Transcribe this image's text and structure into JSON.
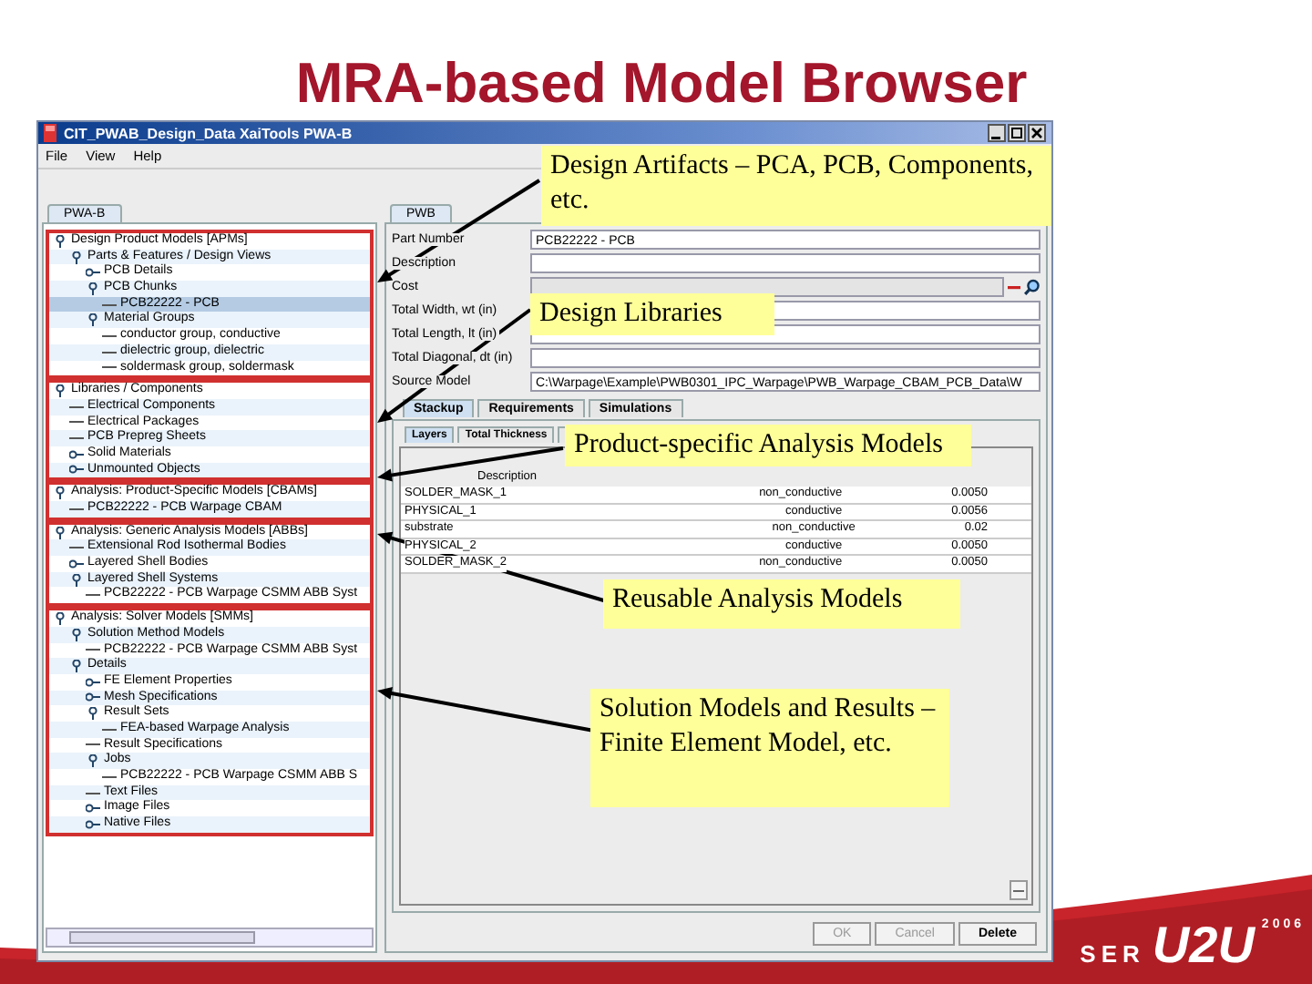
{
  "slide_title": "MRA-based Model Browser",
  "window": {
    "title": "CIT_PWAB_Design_Data   XaiTools PWA-B"
  },
  "menu": [
    "File",
    "View",
    "Help"
  ],
  "left_panel": {
    "tab": "PWA-B",
    "sections": [
      {
        "items": [
          {
            "label": "Design Product Models [APMs]",
            "expanded": true,
            "selected": false,
            "children": [
              {
                "label": "Parts & Features / Design Views",
                "expanded": true,
                "selected": false,
                "children": [
                  {
                    "label": "PCB Details",
                    "expanded": false,
                    "selected": false
                  },
                  {
                    "label": "PCB Chunks",
                    "expanded": true,
                    "selected": false,
                    "children": [
                      {
                        "label": "PCB22222 - PCB",
                        "selected": true
                      }
                    ]
                  },
                  {
                    "label": "Material Groups",
                    "expanded": true,
                    "selected": false,
                    "children": [
                      {
                        "label": "conductor group, conductive",
                        "selected": false
                      },
                      {
                        "label": "dielectric group, dielectric",
                        "selected": false
                      },
                      {
                        "label": "soldermask group, soldermask",
                        "selected": false
                      }
                    ]
                  }
                ]
              }
            ]
          }
        ]
      },
      {
        "items": [
          {
            "label": "Libraries / Components",
            "expanded": true,
            "selected": false,
            "children": [
              {
                "label": "Electrical Components",
                "selected": false
              },
              {
                "label": "Electrical Packages",
                "selected": false
              },
              {
                "label": "PCB Prepreg Sheets",
                "selected": false
              },
              {
                "label": "Solid Materials",
                "expanded": false,
                "selected": false
              },
              {
                "label": "Unmounted Objects",
                "expanded": false,
                "selected": false
              }
            ]
          }
        ]
      },
      {
        "items": [
          {
            "label": "Analysis: Product-Specific Models [CBAMs]",
            "expanded": true,
            "selected": false,
            "children": [
              {
                "label": "PCB22222 - PCB Warpage CBAM",
                "selected": false
              }
            ]
          }
        ]
      },
      {
        "items": [
          {
            "label": "Analysis: Generic Analysis Models [ABBs]",
            "expanded": true,
            "selected": false,
            "children": [
              {
                "label": "Extensional Rod Isothermal Bodies",
                "selected": false
              },
              {
                "label": "Layered Shell Bodies",
                "expanded": false,
                "selected": false
              },
              {
                "label": "Layered Shell Systems",
                "expanded": true,
                "selected": false,
                "children": [
                  {
                    "label": "PCB22222 - PCB Warpage CSMM ABB Syst",
                    "selected": false
                  }
                ]
              }
            ]
          }
        ]
      },
      {
        "items": [
          {
            "label": "Analysis: Solver Models [SMMs]",
            "expanded": true,
            "selected": false,
            "children": [
              {
                "label": "Solution Method Models",
                "expanded": true,
                "selected": false,
                "children": [
                  {
                    "label": "PCB22222 - PCB Warpage CSMM ABB Syst",
                    "selected": false
                  }
                ]
              },
              {
                "label": "Details",
                "expanded": true,
                "selected": false,
                "children": [
                  {
                    "label": "FE Element Properties",
                    "expanded": false,
                    "selected": false
                  },
                  {
                    "label": "Mesh Specifications",
                    "expanded": false,
                    "selected": false
                  },
                  {
                    "label": "Result Sets",
                    "expanded": true,
                    "selected": false,
                    "children": [
                      {
                        "label": "FEA-based Warpage Analysis",
                        "selected": false
                      }
                    ]
                  },
                  {
                    "label": "Result Specifications",
                    "selected": false
                  },
                  {
                    "label": "Jobs",
                    "expanded": true,
                    "selected": false,
                    "children": [
                      {
                        "label": "PCB22222 - PCB Warpage CSMM ABB S",
                        "selected": false
                      }
                    ]
                  },
                  {
                    "label": "Text Files",
                    "selected": false
                  },
                  {
                    "label": "Image Files",
                    "expanded": false,
                    "selected": false
                  },
                  {
                    "label": "Native Files",
                    "expanded": false,
                    "selected": false
                  }
                ]
              }
            ]
          }
        ]
      }
    ]
  },
  "right_panel": {
    "tab": "PWB",
    "fields": [
      {
        "label": "Part Number",
        "value": "PCB22222 - PCB",
        "kind": "text"
      },
      {
        "label": "Description",
        "kind": "text"
      },
      {
        "label": "Cost",
        "kind": "lookup"
      },
      {
        "label": "Total Width, wt (in)",
        "kind": "text"
      },
      {
        "label": "Total Length, lt (in)",
        "kind": "text"
      },
      {
        "label": "Total Diagonal, dt (in)",
        "kind": "text"
      },
      {
        "label": "Source Model",
        "value": "C:\\Warpage\\Example\\PWB0301_IPC_Warpage\\PWB_Warpage_CBAM_PCB_Data\\W",
        "kind": "text"
      }
    ],
    "tabs": [
      {
        "label": "Stackup",
        "selected": true
      },
      {
        "label": "Requirements",
        "selected": false
      },
      {
        "label": "Simulations",
        "selected": false
      }
    ],
    "subtabs": [
      {
        "label": "Layers",
        "selected": true
      },
      {
        "label": "Total Thickness",
        "selected": false
      }
    ],
    "table": {
      "columns": [
        "Description"
      ],
      "rows": [
        [
          "SOLDER_MASK_1",
          "non_conductive",
          "0.0050"
        ],
        [
          "PHYSICAL_1",
          "conductive",
          "0.0056"
        ],
        [
          "substrate",
          "non_conductive",
          "0.02"
        ],
        [
          "PHYSICAL_2",
          "conductive",
          "0.0050"
        ],
        [
          "SOLDER_MASK_2",
          "non_conductive",
          "0.0050"
        ]
      ]
    },
    "buttons": [
      {
        "label": "OK",
        "disabled": true
      },
      {
        "label": "Cancel",
        "disabled": true
      },
      {
        "label": "Delete",
        "disabled": false
      }
    ]
  },
  "callouts": [
    "Design Artifacts – PCA, PCB, Components, etc.",
    "Design Libraries",
    "Product-specific Analysis Models",
    "Reusable Analysis Models",
    "Solution Models and Results – Finite Element Model, etc."
  ],
  "logo": {
    "text": "SER",
    "mark": "U2U",
    "year": "2006"
  }
}
